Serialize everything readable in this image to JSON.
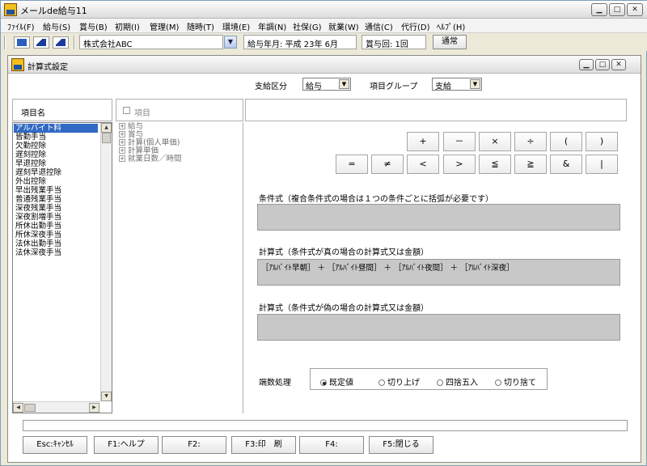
{
  "app": {
    "title": "メールde給与11"
  },
  "menu": [
    "ﾌｧｲﾙ(F)",
    "給与(S)",
    "賞与(B)",
    "初期(I)",
    "管理(M)",
    "随時(T)",
    "環境(E)",
    "年調(N)",
    "社保(G)",
    "就業(W)",
    "通信(C)",
    "代行(D)",
    "ﾍﾙﾌﾟ(H)"
  ],
  "toolbar": {
    "company": "株式会社ABC",
    "pay_month": "給与年月: 平成 23年  6月",
    "bonus_count": "賞与回: 1回",
    "mode_button": "通常"
  },
  "dialog": {
    "title": "計算式設定",
    "category_label": "支給区分",
    "category_value": "給与",
    "group_label": "項目グループ",
    "group_value": "支給",
    "list_header": "項目名",
    "items": [
      "アルバイト料",
      "皆勤手当",
      "欠勤控除",
      "遅刻控除",
      "早退控除",
      "遅刻早退控除",
      "外出控除",
      "早出残業手当",
      "普通残業手当",
      "深夜残業手当",
      "深夜割増手当",
      "所休出勤手当",
      "所休深夜手当",
      "法休出勤手当",
      "法休深夜手当"
    ],
    "tree_header": "項目",
    "tree": [
      "給与",
      "賞与",
      "計算(個人単価)",
      "計算単価",
      "就業日数／時間"
    ],
    "operators_row1": [
      "+",
      "－",
      "×",
      "÷",
      "(",
      ")"
    ],
    "operators_row2": [
      "=",
      "≠",
      "<",
      ">",
      "≦",
      "≧",
      "&",
      "|"
    ],
    "condition_label": "条件式（複合条件式の場合は１つの条件ごとに括弧が必要です）",
    "condition_value": "",
    "true_formula_label": "計算式（条件式が真の場合の計算式又は金額）",
    "true_formula_value": "［ｱﾙﾊﾞｲﾄ早朝］ ＋ ［ｱﾙﾊﾞｲﾄ昼間］ ＋ ［ｱﾙﾊﾞｲﾄ夜間］ ＋ ［ｱﾙﾊﾞｲﾄ深夜］",
    "false_formula_label": "計算式（条件式が偽の場合の計算式又は金額）",
    "false_formula_value": "",
    "rounding_label": "端数処理",
    "rounding_options": [
      "既定値",
      "切り上げ",
      "四捨五入",
      "切り捨て"
    ],
    "rounding_selected": "既定値",
    "fkeys": [
      "Esc:ｷｬﾝｾﾙ",
      "F1:ヘルプ",
      "F2:",
      "F3:印　刷",
      "F4:",
      "F5:閉じる"
    ]
  }
}
